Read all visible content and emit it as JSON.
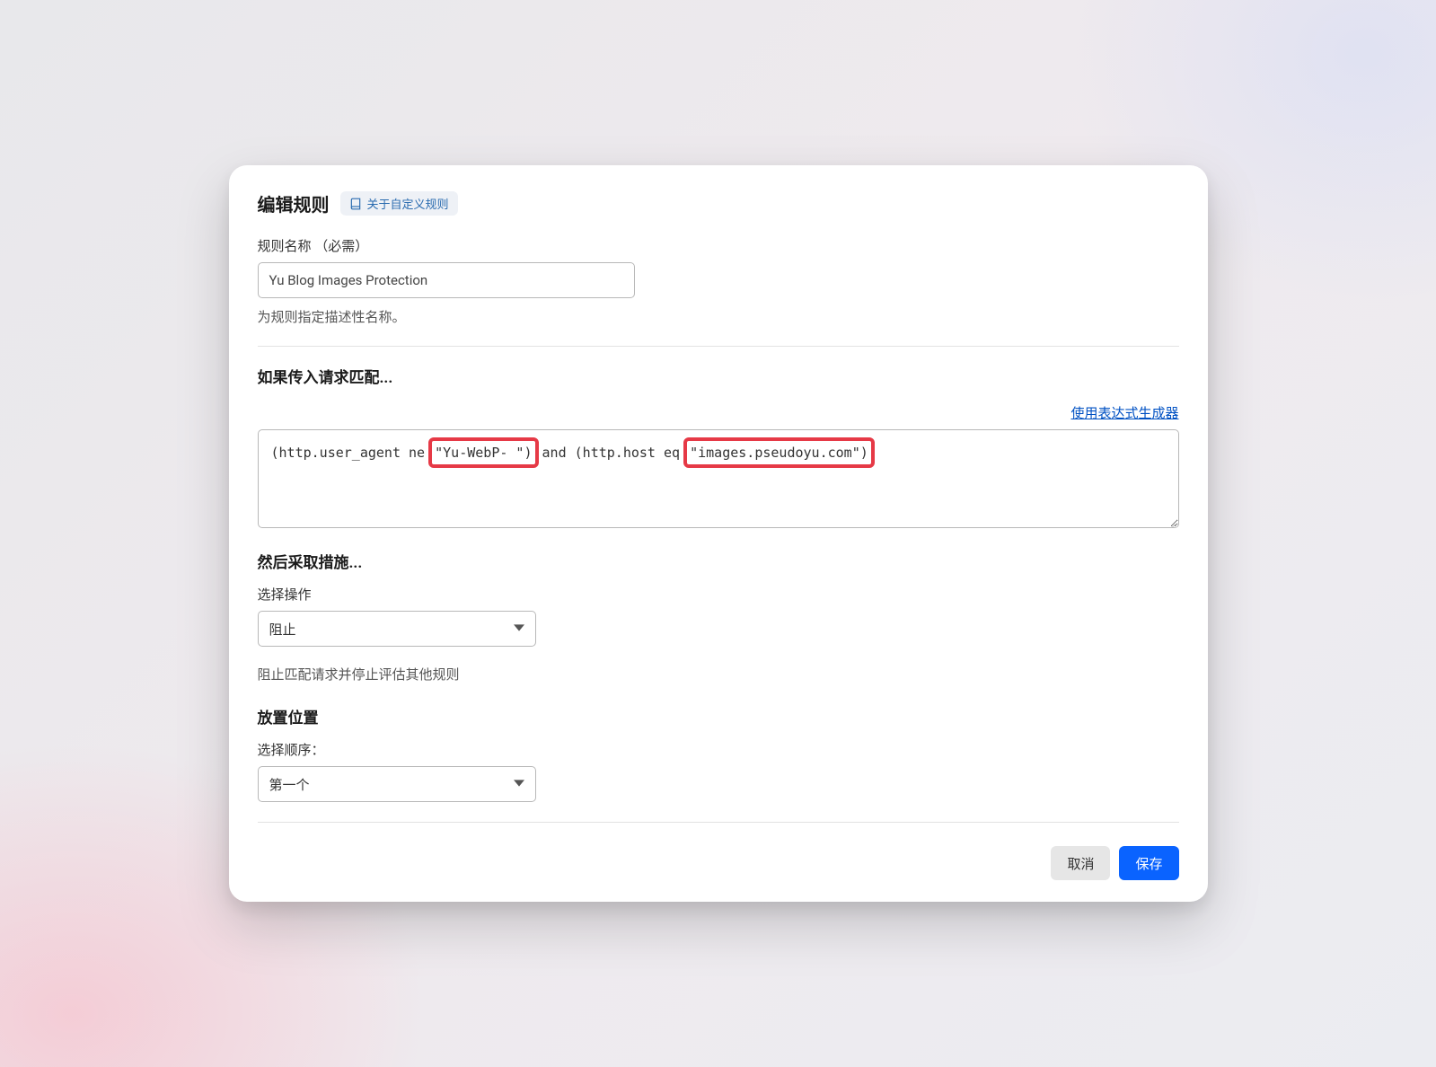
{
  "header": {
    "title": "编辑规则",
    "badge_label": "关于自定义规则"
  },
  "rule_name": {
    "label": "规则名称 （必需）",
    "value": "Yu Blog Images Protection",
    "helper": "为规则指定描述性名称。"
  },
  "match_section": {
    "heading": "如果传入请求匹配...",
    "generator_link": "使用表达式生成器",
    "expr": {
      "pre1": "(http.user_agent ne ",
      "highlight1": "\"Yu-WebP-        \")",
      "mid": " and (http.host eq ",
      "highlight2": "\"images.pseudoyu.com\")",
      "post": ""
    }
  },
  "action_section": {
    "heading": "然后采取措施...",
    "select_label": "选择操作",
    "selected": "阻止",
    "helper": "阻止匹配请求并停止评估其他规则"
  },
  "placement_section": {
    "heading": "放置位置",
    "select_label": "选择顺序：",
    "selected": "第一个"
  },
  "footer": {
    "cancel": "取消",
    "save": "保存"
  }
}
